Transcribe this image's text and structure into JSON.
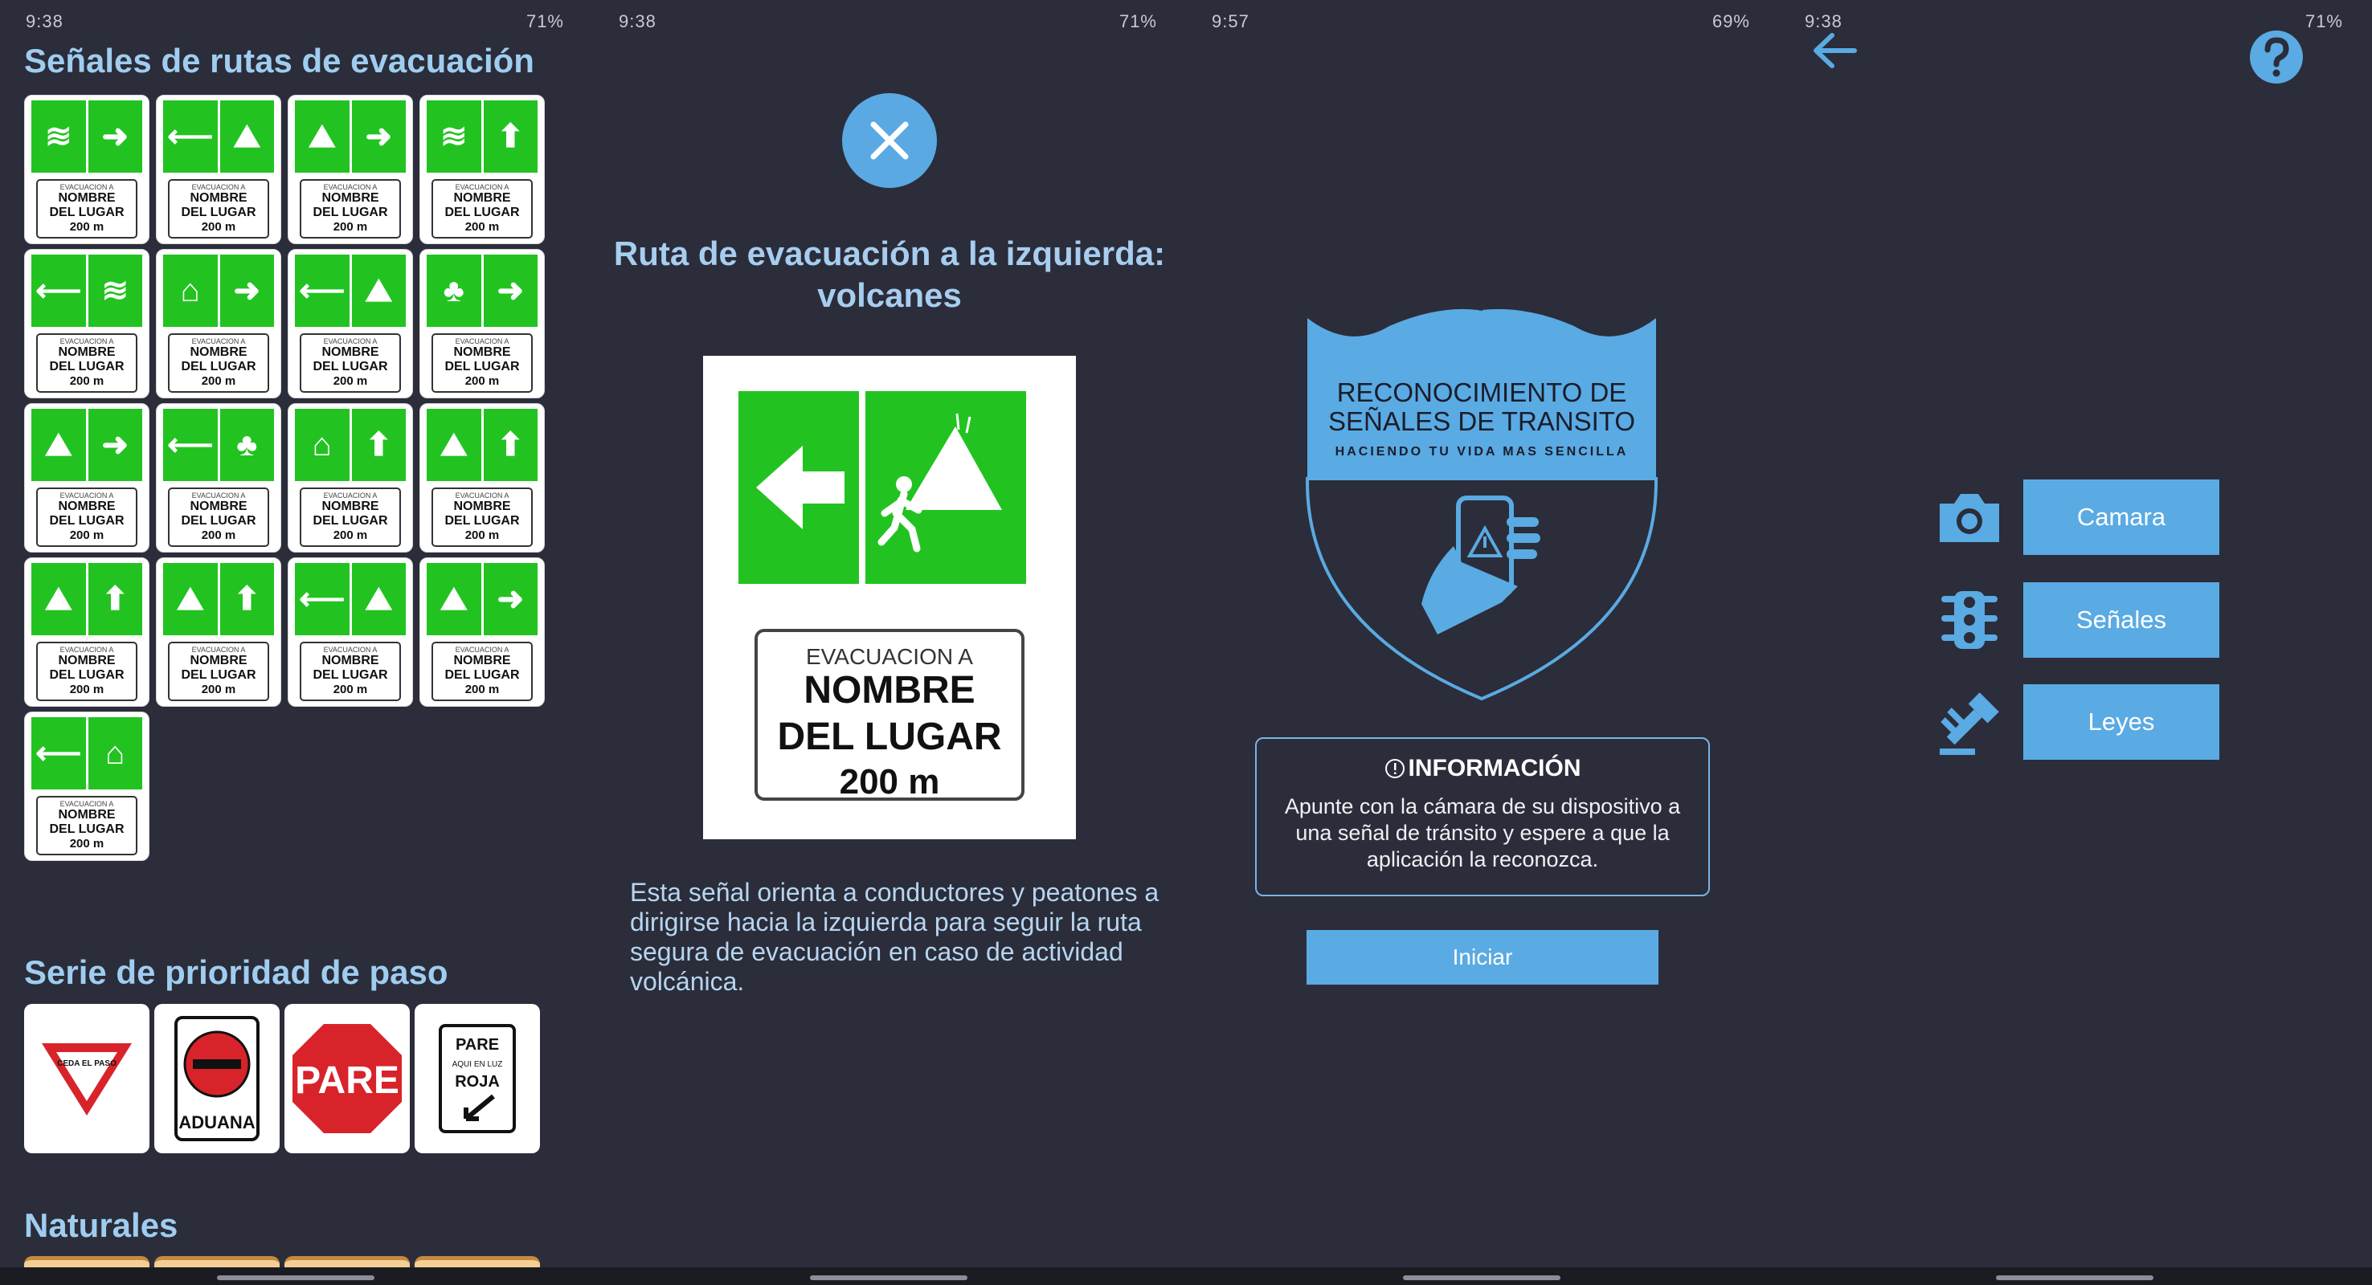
{
  "status_bars": [
    {
      "time": "9:38",
      "right": "71%"
    },
    {
      "time": "9:38",
      "right": "71%"
    },
    {
      "time": "9:57",
      "right": "69%"
    },
    {
      "time": "9:38",
      "right": "71%"
    }
  ],
  "catalog": {
    "section_evacuation": "Señales de rutas de evacuación",
    "section_priority": "Serie de prioridad de paso",
    "section_natural": "Naturales",
    "plate_small": "EVACUACION A",
    "plate_line1": "NOMBRE",
    "plate_line2": "DEL LUGAR",
    "plate_distance": "200 m",
    "evac_signs": [
      {
        "left": "≋",
        "right": "➜"
      },
      {
        "left": "⟵",
        "right": "⛰"
      },
      {
        "left": "⛰",
        "right": "➜"
      },
      {
        "left": "≋",
        "right": "⬆"
      },
      {
        "left": "⟵",
        "right": "≋"
      },
      {
        "left": "⌂",
        "right": "➜"
      },
      {
        "left": "⟵",
        "right": "⛰"
      },
      {
        "left": "♣",
        "right": "➜"
      },
      {
        "left": "⛰",
        "right": "➜"
      },
      {
        "left": "⟵",
        "right": "♣"
      },
      {
        "left": "⌂",
        "right": "⬆"
      },
      {
        "left": "⛰",
        "right": "⬆"
      },
      {
        "left": "⛰",
        "right": "⬆"
      },
      {
        "left": "⛰",
        "right": "⬆"
      },
      {
        "left": "⟵",
        "right": "⛰"
      },
      {
        "left": "⛰",
        "right": "➜"
      },
      {
        "left": "⟵",
        "right": "⌂"
      }
    ],
    "priority_signs": {
      "yield": "CEDA EL PASO",
      "customs": "ADUANA",
      "stop": "PARE",
      "stop_here_l1": "PARE",
      "stop_here_l2": "AQUI EN LUZ",
      "stop_here_l3": "ROJA"
    }
  },
  "detail": {
    "title_line1": "Ruta de evacuación a la izquierda:",
    "title_line2": "volcanes",
    "sign_small": "EVACUACION A",
    "sign_line1": "NOMBRE",
    "sign_line2": "DEL LUGAR",
    "sign_distance": "200 m",
    "description": "Esta señal orienta a conductores y peatones a dirigirse hacia la izquierda para seguir la ruta segura de evacuación en caso de actividad volcánica."
  },
  "home": {
    "logo_line1": "RECONOCIMIENTO DE",
    "logo_line2": "SEÑALES DE TRANSITO",
    "logo_tagline": "HACIENDO TU VIDA MAS SENCILLA",
    "info_title": "INFORMACIÓN",
    "info_text": "Apunte con la cámara de su dispositivo a una señal de tránsito y espere a que la aplicación la reconozca.",
    "start_label": "Iniciar"
  },
  "menu": {
    "items": [
      {
        "label": "Camara",
        "icon": "camera-icon"
      },
      {
        "label": "Señales",
        "icon": "traffic-light-icon"
      },
      {
        "label": "Leyes",
        "icon": "gavel-icon"
      }
    ]
  },
  "colors": {
    "background": "#2b2d3a",
    "accent": "#5aaae3",
    "sign_green": "#22c321",
    "heading": "#9fcdf0"
  }
}
